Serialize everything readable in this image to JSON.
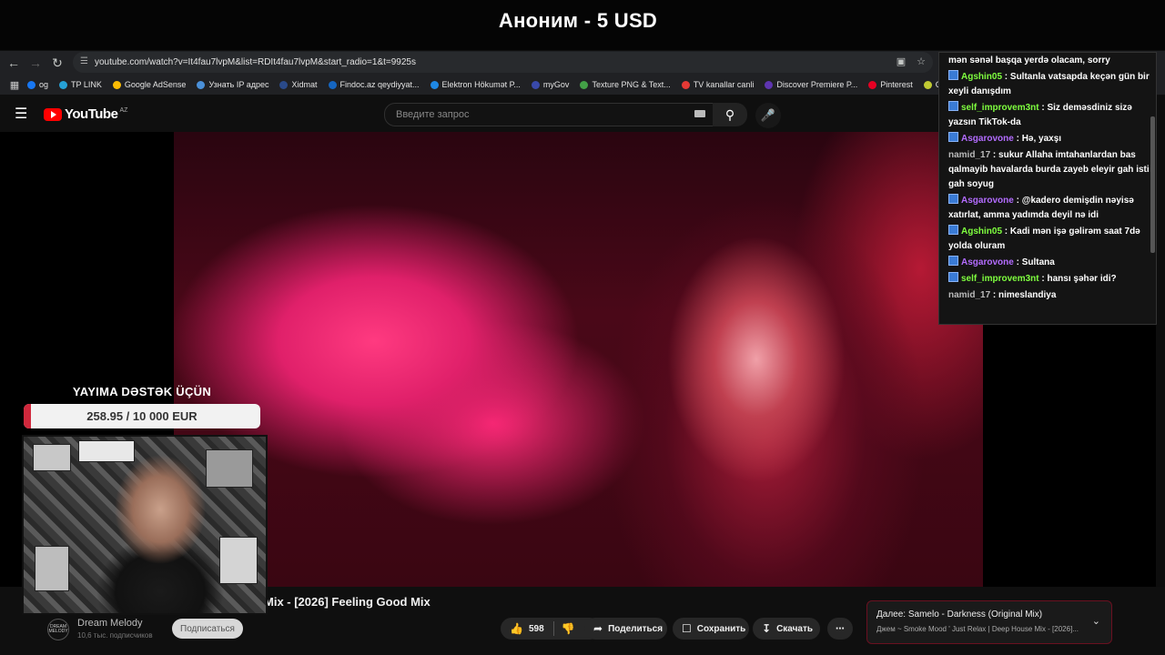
{
  "overlay": {
    "donation_title": "Аноним - 5 USD",
    "support_label": "YAYIMA DƏSTƏK ÜÇÜN",
    "goal_text": "258.95 / 10 000 EUR",
    "goal_fraction": 0.026
  },
  "browser": {
    "url": "youtube.com/watch?v=It4fau7lvpM&list=RDIt4fau7lvpM&start_radio=1&t=9925s",
    "bookmarks": [
      {
        "label": "og",
        "color": "#1877f2"
      },
      {
        "label": "TP LINK",
        "color": "#26a1d6"
      },
      {
        "label": "Google AdSense",
        "color": "#fbbc04"
      },
      {
        "label": "Узнать IP адрес",
        "color": "#4a90d9"
      },
      {
        "label": "Xidmat",
        "color": "#2a4a8a"
      },
      {
        "label": "Findoc.az qeydiyyat...",
        "color": "#1565c0"
      },
      {
        "label": "Elektron Hökumət P...",
        "color": "#1e88e5"
      },
      {
        "label": "myGov",
        "color": "#3949ab"
      },
      {
        "label": "Texture PNG & Text...",
        "color": "#43a047"
      },
      {
        "label": "TV kanallar canli",
        "color": "#e53935"
      },
      {
        "label": "Discover Premiere P...",
        "color": "#5e35b1"
      },
      {
        "label": "Pinterest",
        "color": "#e60023"
      },
      {
        "label": "Словарь игровых т...",
        "color": "#c0ca33"
      }
    ]
  },
  "youtube": {
    "logo_text": "YouTube",
    "region": "AZ",
    "search_placeholder": "Введите запрос",
    "video_title": "Mix - [2026] Feeling Good Mix",
    "channel_name": "Dream Melody",
    "channel_avatar_text": "DREAM MELODY",
    "subscribers": "10,6 тыс. подписчиков",
    "subscribe_label": "Подписаться",
    "likes": "598",
    "share_label": "Поделиться",
    "save_label": "Сохранить",
    "download_label": "Скачать",
    "next_title": "Далее: Samelo - Darkness (Original Mix)",
    "next_subtitle": "Джем ~ Smoke Mood ' Just Relax | Deep House Mix - [2026]..."
  },
  "chat": {
    "messages": [
      {
        "user": "",
        "text": "mən sənəl başqa yerdə olacam, sorry",
        "color": "#ffffff",
        "badge": false
      },
      {
        "user": "Agshin05",
        "text": "Sultanla vatsapda keçən gün bir xeyli danışdım",
        "color": "#7fff3f",
        "badge": true
      },
      {
        "user": "self_improvem3nt",
        "text": "Siz deməsdiniz sizə yazsın TikTok-da",
        "color": "#7fff3f",
        "badge": true
      },
      {
        "user": "Asgarovone",
        "text": "Hə, yaxşı",
        "color": "#b36cff",
        "badge": true
      },
      {
        "user": "namid_17",
        "text": "sukur Allaha imtahanlardan bas qalmayib havalarda burda zayeb eleyir gah isti gah soyug",
        "color": "#bbbbbb",
        "badge": false
      },
      {
        "user": "Asgarovone",
        "text": "@kadero demişdin nəyisə xatırlat, amma yadımda deyil nə idi",
        "color": "#b36cff",
        "badge": true
      },
      {
        "user": "Agshin05",
        "text": "Kadi mən işə gəlirəm saat 7də yolda oluram",
        "color": "#7fff3f",
        "badge": true
      },
      {
        "user": "Asgarovone",
        "text": "Sultana",
        "color": "#b36cff",
        "badge": true
      },
      {
        "user": "self_improvem3nt",
        "text": "hansı şəhər idi?",
        "color": "#7fff3f",
        "badge": true
      },
      {
        "user": "namid_17",
        "text": "nimeslandiya",
        "color": "#bbbbbb",
        "badge": false
      }
    ]
  }
}
